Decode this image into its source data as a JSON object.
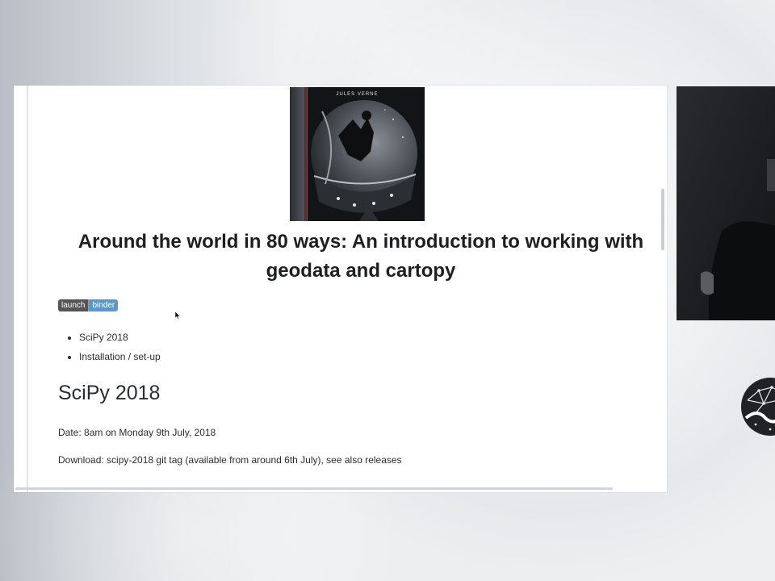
{
  "book_cover": {
    "author": "JULES VERNE"
  },
  "page": {
    "title": "Around the world in 80 ways: An introduction to working with geodata and cartopy",
    "badge": {
      "left_label": "launch",
      "right_label": "binder"
    },
    "toc": [
      "SciPy 2018",
      "Installation / set-up"
    ],
    "section_heading": "SciPy 2018",
    "date_line": "Date: 8am on Monday 9th July, 2018",
    "download_line": "Download: scipy-2018 git tag (available from around 6th July), see also releases"
  },
  "colors": {
    "badge_left": "#555555",
    "badge_right": "#579aca",
    "text": "#2a2c2f"
  },
  "icons": {
    "cursor": "mouse-pointer-icon",
    "logo": "scipy-logo-icon"
  }
}
